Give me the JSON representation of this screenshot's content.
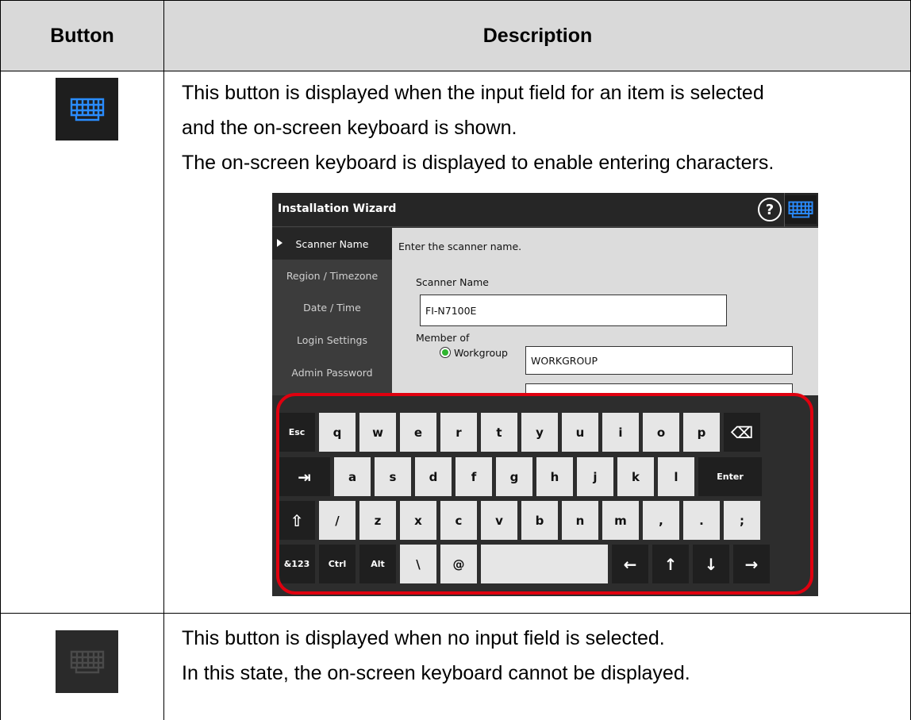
{
  "table": {
    "col_button": "Button",
    "col_description": "Description"
  },
  "row1": {
    "button_icon": "keyboard-icon-active",
    "description": [
      "This button is displayed when the input field for an item is selected",
      "and the on-screen keyboard is shown.",
      "The on-screen keyboard is displayed to enable entering characters."
    ]
  },
  "row2": {
    "button_icon": "keyboard-icon-disabled",
    "description": [
      "This button is displayed when no input field is selected.",
      "In this state, the on-screen keyboard cannot be displayed."
    ]
  },
  "screenshot": {
    "title": "Installation Wizard",
    "help_label": "?",
    "sidebar": [
      {
        "label": "Scanner Name",
        "active": true
      },
      {
        "label": "Region / Timezone",
        "active": false
      },
      {
        "label": "Date / Time",
        "active": false
      },
      {
        "label": "Login Settings",
        "active": false
      },
      {
        "label": "Admin Password",
        "active": false
      }
    ],
    "prompt": "Enter the scanner name.",
    "scanner_name_label": "Scanner Name",
    "scanner_name_value": "FI-N7100E",
    "member_of_label": "Member of",
    "workgroup_label": "Workgroup",
    "workgroup_value": "WORKGROUP",
    "keyboard": {
      "row1": [
        "Esc",
        "q",
        "w",
        "e",
        "r",
        "t",
        "y",
        "u",
        "i",
        "o",
        "p",
        "⌫"
      ],
      "row2": [
        "⇥",
        "a",
        "s",
        "d",
        "f",
        "g",
        "h",
        "j",
        "k",
        "l",
        "Enter"
      ],
      "row3": [
        "⇧",
        "/",
        "z",
        "x",
        "c",
        "v",
        "b",
        "n",
        "m",
        ",",
        ".",
        ";"
      ],
      "row4": [
        "&123",
        "Ctrl",
        "Alt",
        "\\",
        "@",
        "",
        "←",
        "↑",
        "↓",
        "→"
      ]
    }
  },
  "colors": {
    "header_bg": "#d9d9d9",
    "highlight": "#e0000f",
    "keyboard_icon_blue": "#2a8cff"
  }
}
